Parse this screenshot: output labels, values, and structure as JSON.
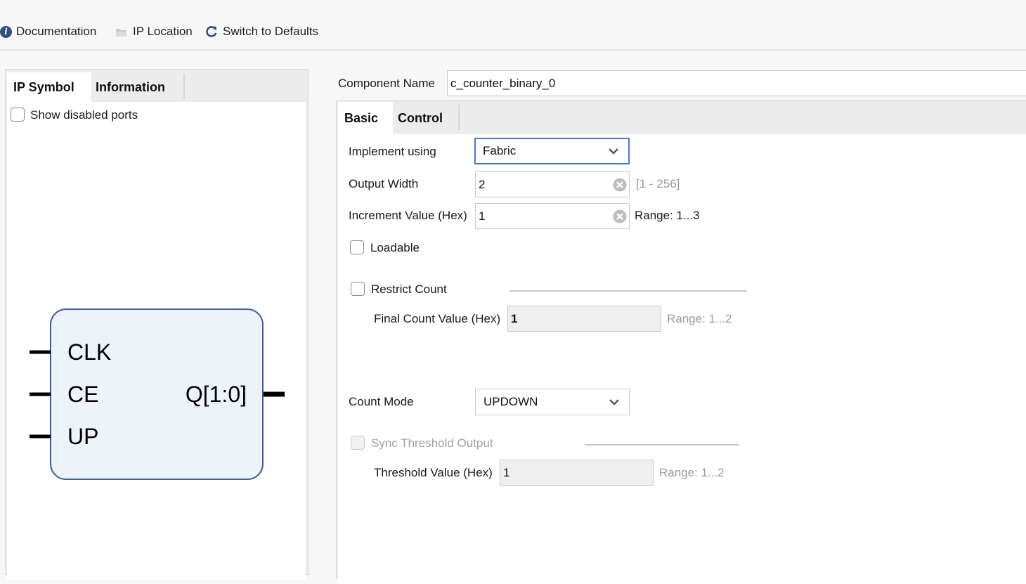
{
  "toolbar": {
    "documentation": {
      "label": "Documentation",
      "icon": "info-icon"
    },
    "ip_location": {
      "label": "IP Location",
      "icon": "folder-icon"
    },
    "switch_defaults": {
      "label": "Switch to Defaults",
      "icon": "refresh-icon"
    }
  },
  "left_panel": {
    "tabs": [
      {
        "label": "IP Symbol",
        "active": true
      },
      {
        "label": "Information",
        "active": false
      }
    ],
    "show_disabled_ports": {
      "label": "Show disabled ports",
      "checked": false
    },
    "symbol": {
      "inputs": [
        "CLK",
        "CE",
        "UP"
      ],
      "outputs": [
        "Q[1:0]"
      ],
      "fill": "#eef3fa",
      "stroke": "#3c5f96"
    }
  },
  "component": {
    "label": "Component Name",
    "value": "c_counter_binary_0"
  },
  "right_panel": {
    "tabs": [
      {
        "label": "Basic",
        "active": true
      },
      {
        "label": "Control",
        "active": false
      }
    ],
    "implement_using": {
      "label": "Implement using",
      "value": "Fabric"
    },
    "output_width": {
      "label": "Output Width",
      "value": "2",
      "hint": "[1 - 256]"
    },
    "increment_value": {
      "label": "Increment Value (Hex)",
      "value": "1",
      "hint": "Range: 1...3"
    },
    "loadable": {
      "label": "Loadable",
      "checked": false
    },
    "restrict_count": {
      "label": "Restrict Count",
      "checked": false
    },
    "final_count_value": {
      "label": "Final Count Value (Hex)",
      "value": "1",
      "hint": "Range: 1...2",
      "disabled": true
    },
    "count_mode": {
      "label": "Count Mode",
      "value": "UPDOWN"
    },
    "sync_threshold_output": {
      "label": "Sync Threshold Output",
      "checked": false,
      "disabled": true
    },
    "threshold_value": {
      "label": "Threshold Value (Hex)",
      "value": "1",
      "hint": "Range: 1...2",
      "disabled": true
    }
  },
  "colors": {
    "accent": "#4a78c9",
    "info_icon": "#2c4f86",
    "refresh_icon": "#2c4f86"
  }
}
